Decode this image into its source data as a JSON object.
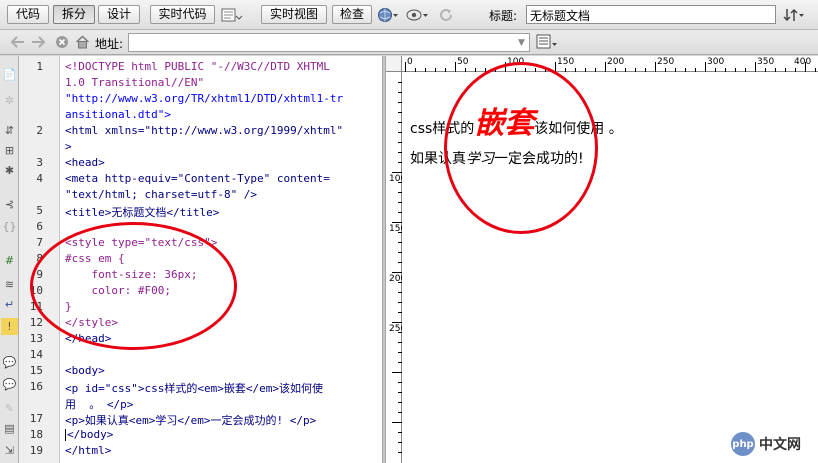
{
  "toolbar": {
    "code_label": "代码",
    "split_label": "拆分",
    "design_label": "设计",
    "live_code_label": "实时代码",
    "live_view_label": "实时视图",
    "inspect_label": "检查",
    "title_label": "标题:",
    "title_value": "无标题文档"
  },
  "nav": {
    "address_label": "地址:",
    "address_value": ""
  },
  "line_numbers": [
    "1",
    "2",
    "3",
    "4",
    "5",
    "6",
    "7",
    "8",
    "9",
    "10",
    "11",
    "12",
    "13",
    "14",
    "15",
    "16",
    "17",
    "18",
    "19"
  ],
  "code_lines": [
    "<!DOCTYPE html PUBLIC \"-//W3C//DTD XHTML",
    "1.0 Transitional//EN\"",
    "\"http://www.w3.org/TR/xhtml1/DTD/xhtml1-tr",
    "ansitional.dtd\">",
    "<html xmlns=\"http://www.w3.org/1999/xhtml\"",
    ">",
    "<head>",
    "<meta http-equiv=\"Content-Type\" content=",
    "\"text/html; charset=utf-8\" />",
    "<title>无标题文档</title>",
    "",
    "<style type=\"text/css\">",
    "#css em {",
    "    font-size: 36px;",
    "    color: #F00;",
    "}",
    "</style>",
    "</head>",
    "",
    "<body>",
    "<p id=\"css\">css样式的<em>嵌套</em>该如何使",
    "用  。 </p>",
    "<p>如果认真<em>学习</em>一定会成功的! </p>",
    "</body>",
    "</html>"
  ],
  "ruler": {
    "h_ticks": [
      "0",
      "50",
      "100",
      "150",
      "200",
      "250",
      "300",
      "350",
      "400"
    ],
    "v_ticks": [
      "100",
      "150",
      "200",
      "250"
    ]
  },
  "design": {
    "p1_before": "css样式的",
    "p1_em": "嵌套",
    "p1_after": "该如何使用 。",
    "p2_before": "如果认真",
    "p2_em": "学习",
    "p2_after": "一定会成功的!"
  },
  "watermark": {
    "badge": "php",
    "text": "中文网"
  },
  "colors": {
    "annotation_red": "#e60012",
    "em_red": "#ff0000"
  }
}
